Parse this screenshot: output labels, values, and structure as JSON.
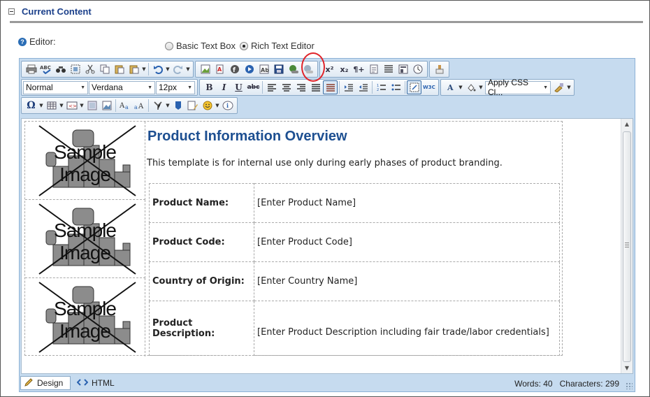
{
  "section": {
    "title": "Current Content"
  },
  "editor_setting": {
    "label": "Editor:",
    "options": [
      {
        "label": "Basic Text Box",
        "selected": false
      },
      {
        "label": "Rich Text Editor",
        "selected": true
      }
    ]
  },
  "toolbar": {
    "format_block": "Normal",
    "font_name": "Verdana",
    "font_size": "12px",
    "apply_css_class": "Apply CSS Cl...",
    "bold": "B",
    "italic": "I",
    "underline": "U",
    "strike": "abc",
    "superscript": "x²",
    "subscript": "x₂",
    "paragraph": "¶+"
  },
  "document": {
    "title": "Product Information Overview",
    "intro": "This template is for internal use only during early phases of product branding.",
    "sample_image_text": [
      "Sample",
      "Image"
    ],
    "rows": [
      {
        "label": "Product Name:",
        "value": "[Enter Product Name]"
      },
      {
        "label": "Product Code:",
        "value": "[Enter Product Code]"
      },
      {
        "label": "Country of Origin:",
        "value": "[Enter Country Name]"
      },
      {
        "label": "Product Description:",
        "value": "[Enter Product Description including fair trade/labor credentials]"
      }
    ]
  },
  "modes": {
    "design": "Design",
    "html": "HTML"
  },
  "stats": {
    "words": "Words: 40",
    "characters": "Characters: 299"
  },
  "colors": {
    "accent": "#1a3f8a",
    "toolbar_bg": "#c6dbef",
    "title": "#1d4f91",
    "highlight": "#e0242a"
  }
}
